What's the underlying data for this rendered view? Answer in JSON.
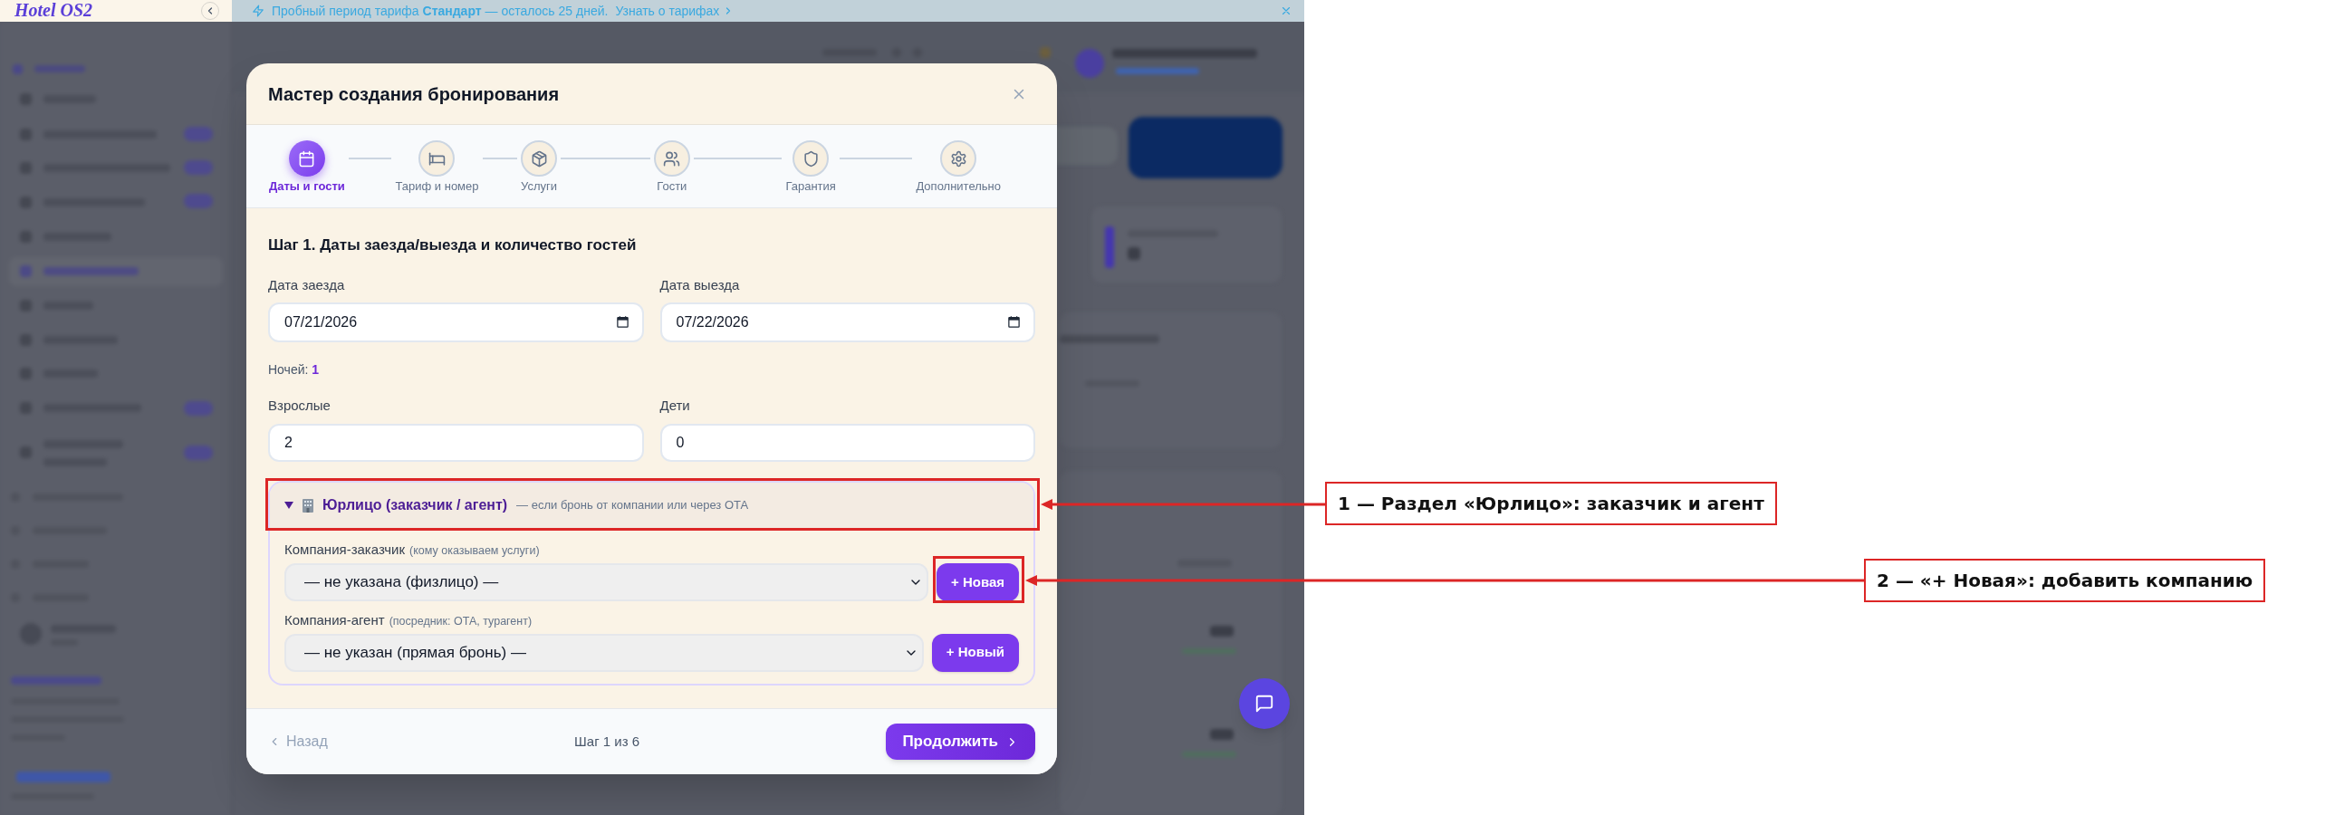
{
  "banner": {
    "text": "Пробный период тарифа **Стандарт** — осталось 25 дней.",
    "link": "Узнать о тарифах"
  },
  "sidebar": {
    "logo": "Hotel OS2"
  },
  "dialog": {
    "title": "Мастер создания бронирования",
    "steps": [
      {
        "label": "Даты и гости",
        "selected": true
      },
      {
        "label": "Тариф и номер",
        "selected": false
      },
      {
        "label": "Услуги",
        "selected": false
      },
      {
        "label": "Гости",
        "selected": false
      },
      {
        "label": "Гарантия",
        "selected": false
      },
      {
        "label": "Дополнительно",
        "selected": false
      }
    ],
    "heading": "Шаг 1. Даты заезда/выезда и количество гостей",
    "date_fields": [
      {
        "label": "Дата заезда",
        "value": "07/21/2026"
      },
      {
        "label": "Дата выезда",
        "value": "07/22/2026"
      }
    ],
    "nights": "Ночей: **1**",
    "guest_fields": [
      {
        "label": "Взрослые",
        "value": "2"
      },
      {
        "label": "Дети",
        "value": "0"
      }
    ],
    "legal_entity": {
      "expanded": true,
      "title": "Юрлицо (заказчик / агент)",
      "hint": "— если бронь от компании или через ОТА",
      "companies": [
        {
          "label": "Компания-заказчик",
          "note": "(кому оказываем услуги)",
          "value": "— не указана (физлицо) —",
          "button": "+ Новая"
        },
        {
          "label": "Компания-агент",
          "note": "(посредник: ОТА, турагент)",
          "value": "— не указан (прямая бронь) —",
          "button": "+ Новый"
        }
      ]
    },
    "footer": {
      "back": {
        "label": "Назад",
        "disabled": true
      },
      "progress": "Шаг 1 из 6",
      "next": "Продолжить"
    }
  },
  "annotations": [
    {
      "text": "1 — Раздел «Юрлицо»: заказчик и агент"
    },
    {
      "text": "2 — «+ Новая»: добавить компанию"
    }
  ]
}
